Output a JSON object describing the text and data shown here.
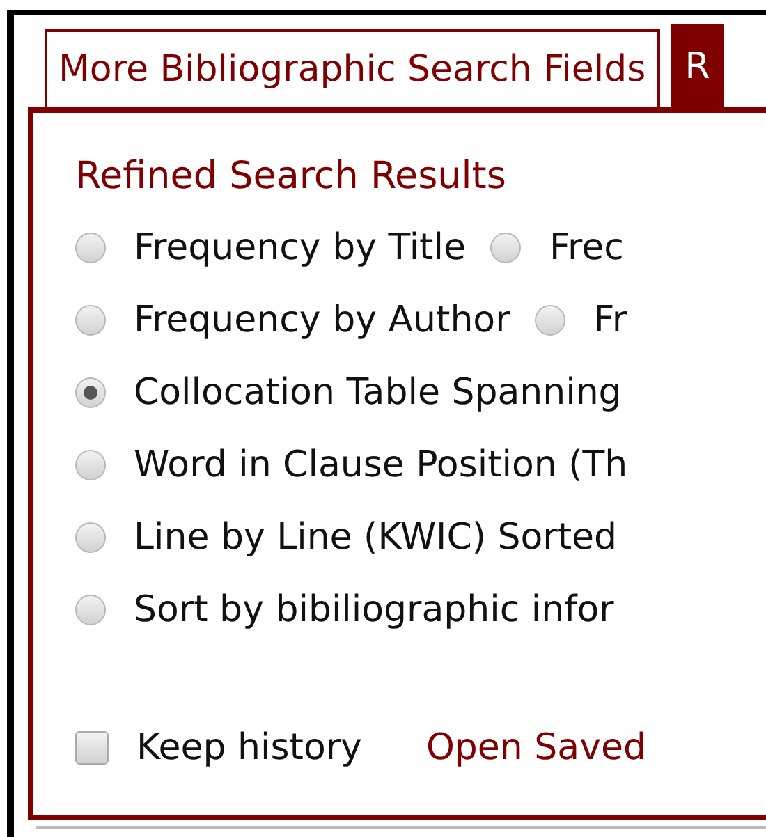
{
  "tabs": [
    {
      "label": "More Bibliographic Search Fields",
      "selected": false
    },
    {
      "label": "R",
      "selected": true
    }
  ],
  "panel": {
    "heading": "Refined Search Results",
    "option_rows": [
      [
        {
          "label": "Frequency by Title",
          "selected": false
        },
        {
          "label": "Frec",
          "selected": false
        }
      ],
      [
        {
          "label": "Frequency by Author",
          "selected": false
        },
        {
          "label": "Fr",
          "selected": false
        }
      ],
      [
        {
          "label": "Collocation Table Spanning",
          "selected": true
        }
      ],
      [
        {
          "label": "Word in Clause Position (Th",
          "selected": false
        }
      ],
      [
        {
          "label": "Line by Line (KWIC) Sorted",
          "selected": false
        }
      ],
      [
        {
          "label": "Sort by bibiliographic infor",
          "selected": false
        }
      ]
    ],
    "keep_history": {
      "label": "Keep history",
      "checked": false
    },
    "link": "Open Saved"
  }
}
